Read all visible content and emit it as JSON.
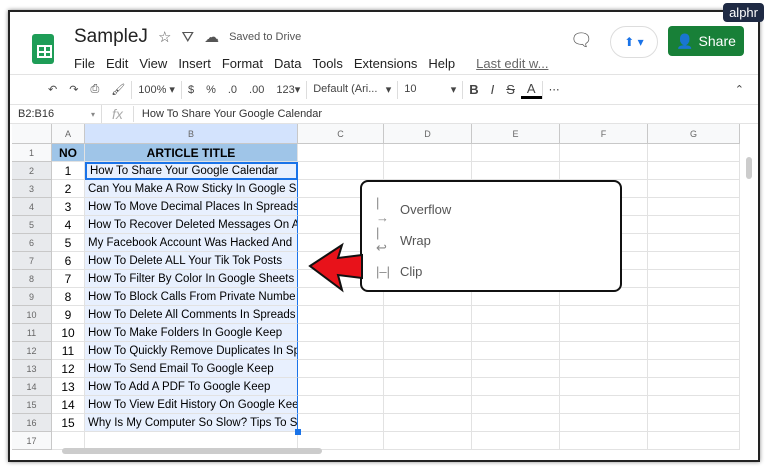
{
  "watermark": "alphr",
  "doc": {
    "title": "SampleJ",
    "saved": "Saved to Drive",
    "share": "Share"
  },
  "menu": [
    "File",
    "Edit",
    "View",
    "Insert",
    "Format",
    "Data",
    "Tools",
    "Extensions",
    "Help"
  ],
  "last_edit": "Last edit w...",
  "toolbar": {
    "zoom": "100%",
    "currency": "$",
    "percent": "%",
    "dec_less": ".0",
    "dec_more": ".00",
    "format": "123",
    "font": "Default (Ari...",
    "size": "10",
    "bold": "B",
    "italic": "I",
    "strike": "S",
    "color": "A",
    "more": "⋯"
  },
  "formula": {
    "range": "B2:B16",
    "fx": "fx",
    "value": "How To Share Your Google Calendar"
  },
  "columns": [
    "A",
    "B",
    "C",
    "D",
    "E",
    "F",
    "G"
  ],
  "rows": [
    "1",
    "2",
    "3",
    "4",
    "5",
    "6",
    "7",
    "8",
    "9",
    "10",
    "11",
    "12",
    "13",
    "14",
    "15",
    "16",
    "17"
  ],
  "header": {
    "no": "NO",
    "title": "ARTICLE TITLE"
  },
  "data": [
    {
      "no": "1",
      "title": "How To Share Your Google Calendar"
    },
    {
      "no": "2",
      "title": "Can You Make A Row Sticky In Google S"
    },
    {
      "no": "3",
      "title": "How To Move Decimal Places In Spreads"
    },
    {
      "no": "4",
      "title": "How To Recover Deleted Messages On A"
    },
    {
      "no": "5",
      "title": "My Facebook Account Was Hacked And"
    },
    {
      "no": "6",
      "title": "How To Delete ALL Your Tik Tok Posts"
    },
    {
      "no": "7",
      "title": "How To Filter By Color In Google Sheets"
    },
    {
      "no": "8",
      "title": "How To Block Calls From Private Numbe"
    },
    {
      "no": "9",
      "title": "How To Delete All Comments In Spreads"
    },
    {
      "no": "10",
      "title": "How To Make Folders In Google Keep"
    },
    {
      "no": "11",
      "title": "How To Quickly Remove Duplicates In Sp"
    },
    {
      "no": "12",
      "title": "How To Send Email To Google Keep"
    },
    {
      "no": "13",
      "title": "How To Add A PDF To Google Keep"
    },
    {
      "no": "14",
      "title": "How To View Edit History On Google Kee"
    },
    {
      "no": "15",
      "title": "Why Is My Computer So Slow? Tips To S"
    }
  ],
  "wrap_menu": [
    "Overflow",
    "Wrap",
    "Clip"
  ],
  "colors": {
    "header_fill": "#9fc5e8",
    "selection": "#e8f0fe",
    "accent": "#1a73e8",
    "arrow": "#e8121a"
  }
}
